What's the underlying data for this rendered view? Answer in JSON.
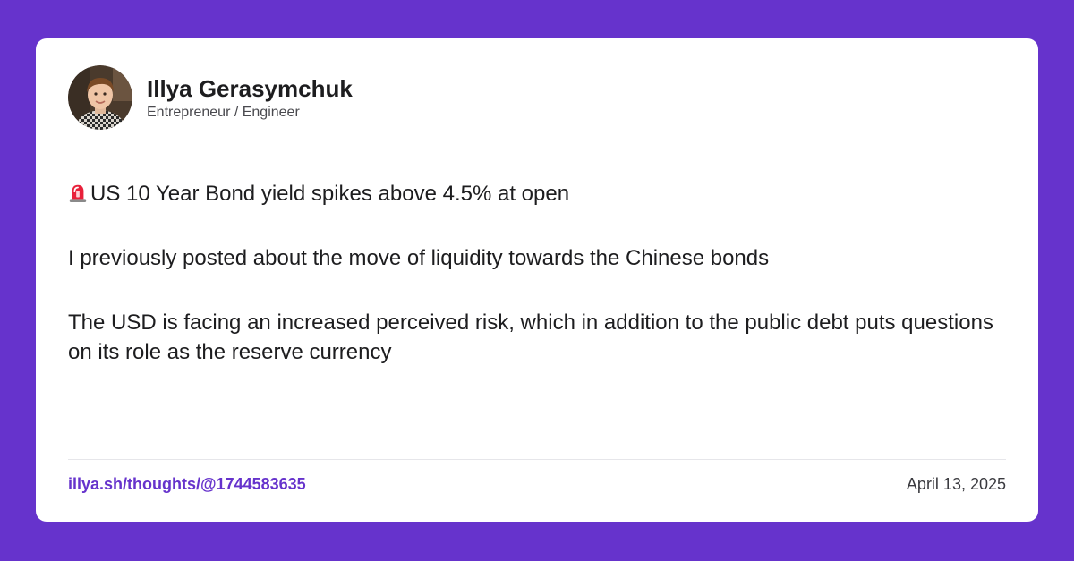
{
  "colors": {
    "background": "#6633cc",
    "card": "#ffffff",
    "link": "#6633cc",
    "text": "#1d1d1f"
  },
  "author": {
    "name": "Illya Gerasymchuk",
    "role": "Entrepreneur / Engineer",
    "avatar_icon": "avatar-photo"
  },
  "post": {
    "alert_icon": "rotating-light-icon",
    "headline": "US 10 Year Bond yield spikes above 4.5% at open",
    "paragraph_2": "I previously posted about the move of liquidity towards the Chinese bonds",
    "paragraph_3": "The USD is facing an increased perceived risk, which in addition to the public debt puts questions on its role as the reserve currency"
  },
  "footer": {
    "link": "illya.sh/thoughts/@1744583635",
    "date": "April 13, 2025"
  }
}
